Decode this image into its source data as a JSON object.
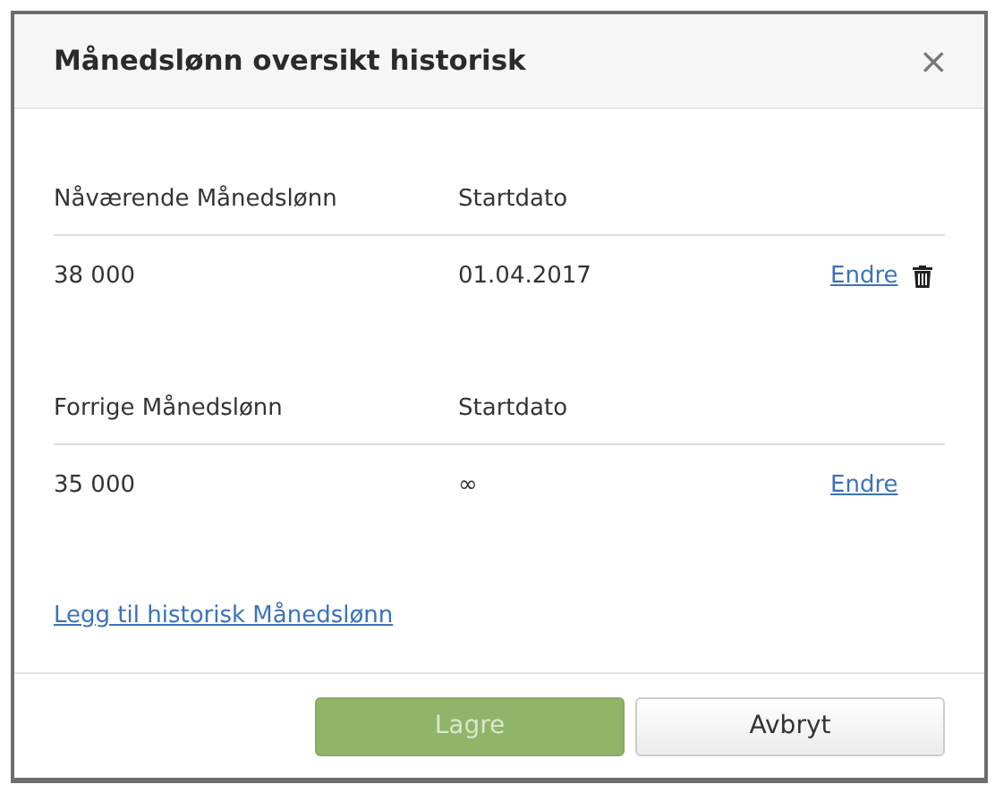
{
  "dialog": {
    "title": "Månedslønn oversikt historisk",
    "close": "×"
  },
  "sections": [
    {
      "columns": [
        "Nåværende Månedslønn",
        "Startdato"
      ],
      "rows": [
        {
          "amount": "38 000",
          "start": "01.04.2017",
          "action": "Endre",
          "deletable": true
        }
      ]
    },
    {
      "columns": [
        "Forrige Månedslønn",
        "Startdato"
      ],
      "rows": [
        {
          "amount": "35 000",
          "start": "∞",
          "action": "Endre",
          "deletable": false
        }
      ]
    }
  ],
  "add_link": "Legg til historisk Månedslønn",
  "buttons": [
    {
      "label": "Lagre",
      "kind": "primary",
      "disabled": true
    },
    {
      "label": "Avbryt",
      "kind": "secondary",
      "disabled": false
    }
  ]
}
